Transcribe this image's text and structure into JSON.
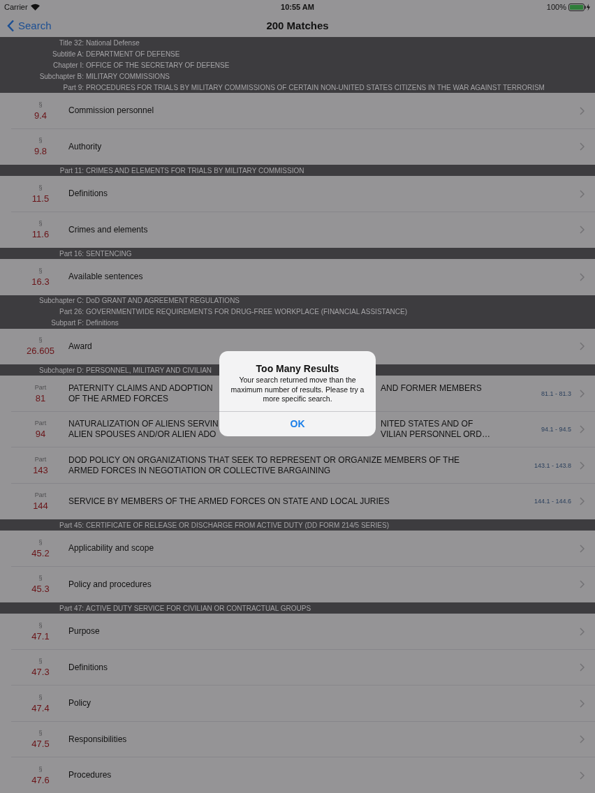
{
  "status_bar": {
    "carrier": "Carrier",
    "time": "10:55 AM",
    "battery": "100%"
  },
  "nav": {
    "back": "Search",
    "title": "200 Matches"
  },
  "list": [
    {
      "kind": "header",
      "lines": [
        {
          "label": "Title 32:",
          "value": "National Defense"
        },
        {
          "label": "Subtitle A:",
          "value": "DEPARTMENT OF DEFENSE"
        },
        {
          "label": "Chapter I:",
          "value": "OFFICE OF THE SECRETARY OF DEFENSE"
        },
        {
          "label": "Subchapter B:",
          "value": "MILITARY COMMISSIONS"
        },
        {
          "label": "Part 9:",
          "value": "PROCEDURES FOR TRIALS BY MILITARY COMMISSIONS OF CERTAIN NON-UNITED STATES CITIZENS IN THE WAR AGAINST TERRORISM"
        }
      ]
    },
    {
      "kind": "item",
      "prefix": "§",
      "number": "9.4",
      "title": "Commission personnel"
    },
    {
      "kind": "item",
      "prefix": "§",
      "number": "9.8",
      "title": "Authority"
    },
    {
      "kind": "header",
      "lines": [
        {
          "label": "Part 11:",
          "value": "CRIMES AND ELEMENTS FOR TRIALS BY MILITARY COMMISSION"
        }
      ]
    },
    {
      "kind": "item",
      "prefix": "§",
      "number": "11.5",
      "title": "Definitions"
    },
    {
      "kind": "item",
      "prefix": "§",
      "number": "11.6",
      "title": "Crimes and elements"
    },
    {
      "kind": "header",
      "lines": [
        {
          "label": "Part 16:",
          "value": "SENTENCING"
        }
      ]
    },
    {
      "kind": "item",
      "prefix": "§",
      "number": "16.3",
      "title": "Available sentences"
    },
    {
      "kind": "header",
      "lines": [
        {
          "label": "Subchapter C:",
          "value": "DoD GRANT AND AGREEMENT REGULATIONS"
        },
        {
          "label": "Part 26:",
          "value": "GOVERNMENTWIDE REQUIREMENTS FOR DRUG-FREE WORKPLACE (FINANCIAL ASSISTANCE)"
        },
        {
          "label": "Subpart F:",
          "value": "Definitions"
        }
      ]
    },
    {
      "kind": "item",
      "prefix": "§",
      "number": "26.605",
      "title": "Award"
    },
    {
      "kind": "header",
      "lines": [
        {
          "label": "Subchapter D:",
          "value": "PERSONNEL, MILITARY AND CIVILIAN"
        }
      ]
    },
    {
      "kind": "item",
      "prefix": "Part",
      "number": "81",
      "title_lines": [
        [
          "PATERNITY CLAIMS AND ADOPTION",
          "AND FORMER MEMBERS"
        ],
        [
          "OF THE ARMED FORCES"
        ]
      ],
      "range": "81.1 - 81.3"
    },
    {
      "kind": "item",
      "prefix": "Part",
      "number": "94",
      "title_lines": [
        [
          "NATURALIZATION OF ALIENS SERVIN",
          "NITED STATES AND OF"
        ],
        [
          "ALIEN SPOUSES AND/OR ALIEN ADO",
          "VILIAN PERSONNEL ORD…"
        ]
      ],
      "range": "94.1 - 94.5"
    },
    {
      "kind": "item",
      "prefix": "Part",
      "number": "143",
      "title": "DOD POLICY ON ORGANIZATIONS THAT SEEK TO REPRESENT OR ORGANIZE MEMBERS OF THE ARMED FORCES IN NEGOTIATION OR COLLECTIVE BARGAINING",
      "range": "143.1 - 143.8"
    },
    {
      "kind": "item",
      "prefix": "Part",
      "number": "144",
      "title": "SERVICE BY MEMBERS OF THE ARMED FORCES ON STATE AND LOCAL JURIES",
      "range": "144.1 - 144.6"
    },
    {
      "kind": "header",
      "lines": [
        {
          "label": "Part 45:",
          "value": "CERTIFICATE OF RELEASE OR DISCHARGE FROM ACTIVE DUTY (DD FORM 214/5 SERIES)"
        }
      ]
    },
    {
      "kind": "item",
      "prefix": "§",
      "number": "45.2",
      "title": "Applicability and scope"
    },
    {
      "kind": "item",
      "prefix": "§",
      "number": "45.3",
      "title": "Policy and procedures"
    },
    {
      "kind": "header",
      "lines": [
        {
          "label": "Part 47:",
          "value": "ACTIVE DUTY SERVICE FOR CIVILIAN OR CONTRACTUAL GROUPS"
        }
      ]
    },
    {
      "kind": "item",
      "prefix": "§",
      "number": "47.1",
      "title": "Purpose"
    },
    {
      "kind": "item",
      "prefix": "§",
      "number": "47.3",
      "title": "Definitions"
    },
    {
      "kind": "item",
      "prefix": "§",
      "number": "47.4",
      "title": "Policy"
    },
    {
      "kind": "item",
      "prefix": "§",
      "number": "47.5",
      "title": "Responsibilities"
    },
    {
      "kind": "item",
      "prefix": "§",
      "number": "47.6",
      "title": "Procedures"
    }
  ],
  "alert": {
    "title": "Too Many Results",
    "message": "Your search returned move than the maximum number of results. Please try a more specific search.",
    "button": "OK"
  }
}
